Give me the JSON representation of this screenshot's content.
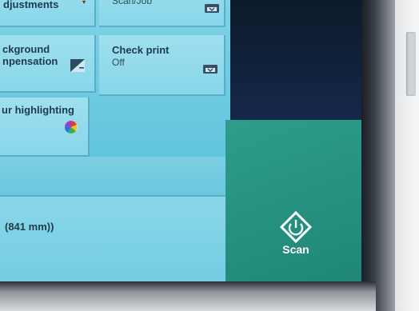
{
  "tiles": {
    "top_left": {
      "title": "djustments"
    },
    "top_right": {
      "sub": "Scan/Job"
    },
    "background": {
      "title_line1": "ckground",
      "title_line2": "npensation"
    },
    "check_print": {
      "title": "Check print",
      "value": "Off"
    },
    "colour_highlighting": {
      "title": "ur highlighting"
    }
  },
  "size_row": {
    "text": "(841 mm))"
  },
  "scan_button": {
    "label": "Scan"
  },
  "icons": {
    "top_left": "pencil-icon",
    "top_right": "printer-icon",
    "background": "background-compensation-icon",
    "check_print": "printer-icon",
    "colour": "colour-palette-icon",
    "scan": "start-diamond-icon"
  },
  "colors": {
    "tile": "#9fe0ef",
    "scan_panel": "#2f9d8c",
    "dark_panel": "#14284a"
  }
}
